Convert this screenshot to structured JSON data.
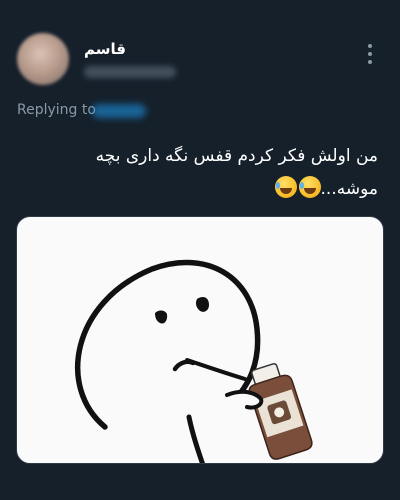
{
  "tweet": {
    "author": {
      "display_name": "قاسم"
    },
    "replying_to_label": "Replying to",
    "text_line1": "من اولش فکر کردم قفس نگه داری بچه",
    "text_line2": "موشه...",
    "emoji": [
      "rolling-on-floor-laughing",
      "rolling-on-floor-laughing"
    ],
    "media": {
      "description_icon": "stick-figure-drinking-bottle"
    }
  },
  "colors": {
    "background": "#15202b",
    "text": "#ffffff",
    "secondary_text": "#8b98a5",
    "accent": "#1d9bf0"
  }
}
